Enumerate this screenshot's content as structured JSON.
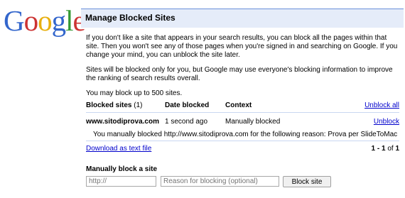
{
  "logo": {
    "letters": [
      {
        "ch": "G",
        "color": "#3366cc"
      },
      {
        "ch": "o",
        "color": "#cc3333"
      },
      {
        "ch": "o",
        "color": "#e8b010"
      },
      {
        "ch": "g",
        "color": "#3366cc"
      },
      {
        "ch": "l",
        "color": "#339933"
      },
      {
        "ch": "e",
        "color": "#cc3333"
      }
    ]
  },
  "header": {
    "title": "Manage Blocked Sites"
  },
  "intro": {
    "p1": "If you don't like a site that appears in your search results, you can block all the pages within that site. Then you won't see any of those pages when you're signed in and searching on Google. If you change your mind, you can unblock the site later.",
    "p2": "Sites will be blocked only for you, but Google may use everyone's blocking information to improve the ranking of search results overall.",
    "p3": "You may block up to 500 sites."
  },
  "table": {
    "headers": {
      "site": "Blocked sites",
      "site_count": "(1)",
      "date": "Date blocked",
      "context": "Context",
      "unblock_all": "Unblock all"
    },
    "rows": [
      {
        "site": "www.sitodiprova.com",
        "date": "1 second ago",
        "context": "Manually blocked",
        "action": "Unblock",
        "reason": "You manually blocked http://www.sitodiprova.com for the following reason: Prova per SlideToMac"
      }
    ]
  },
  "footer": {
    "download": "Download as text file",
    "pager_range": "1 - 1",
    "pager_of": "of",
    "pager_total": "1"
  },
  "manual": {
    "title": "Manually block a site",
    "url_placeholder": "http://",
    "reason_placeholder": "Reason for blocking (optional)",
    "button": "Block site"
  },
  "colors": {
    "header_bg": "#e5ecf9",
    "header_border": "#6b90da",
    "link": "#0000cc"
  }
}
